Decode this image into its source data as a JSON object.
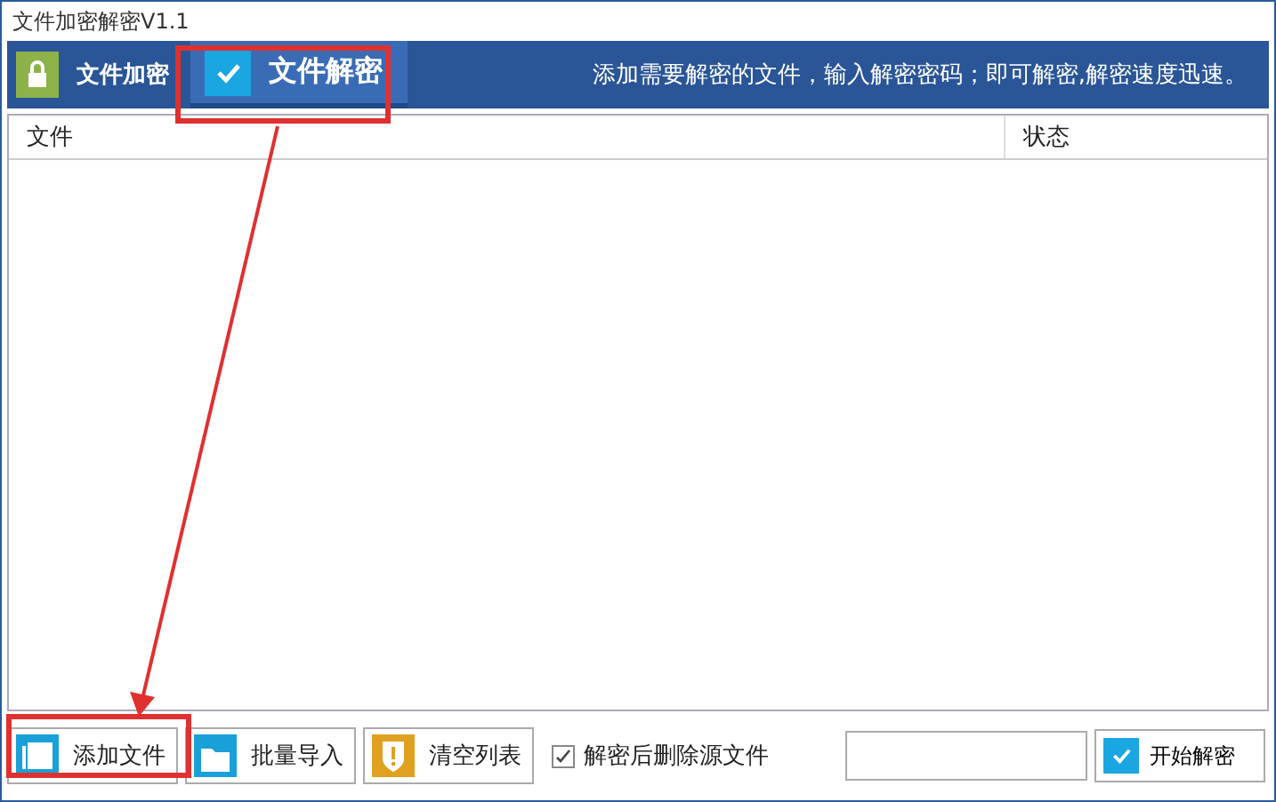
{
  "window": {
    "title": "文件加密解密V1.1"
  },
  "tabs": [
    {
      "label": "文件加密",
      "kind": "lock",
      "selected": false
    },
    {
      "label": "文件解密",
      "kind": "check",
      "selected": true
    }
  ],
  "hint": "添加需要解密的文件，输入解密密码；即可解密,解密速度迅速。",
  "table": {
    "columns": [
      "文件",
      "状态"
    ]
  },
  "buttons": [
    {
      "label": "添加文件",
      "kind": "files"
    },
    {
      "label": "批量导入",
      "kind": "folder"
    },
    {
      "label": "清空列表",
      "kind": "shield"
    }
  ],
  "delete_source": {
    "label": "解密后删除源文件",
    "checked": true
  },
  "start_button": {
    "label": "开始解密"
  }
}
